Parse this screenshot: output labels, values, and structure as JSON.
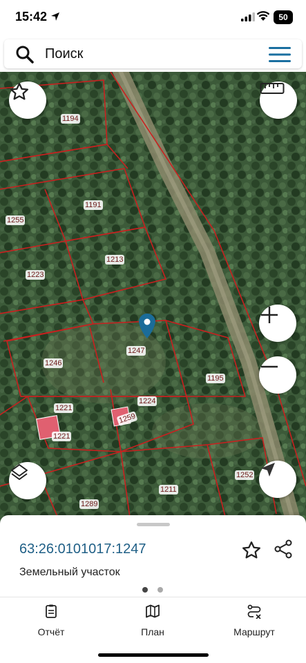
{
  "status_bar": {
    "time": "15:42",
    "battery": "50"
  },
  "search": {
    "placeholder": "Поиск"
  },
  "map": {
    "plot_labels": [
      "1194",
      "1191",
      "1255",
      "1213",
      "1223",
      "1247",
      "1246",
      "1195",
      "1221",
      "1224",
      "1259",
      "1221",
      "1252",
      "1211",
      "1289"
    ],
    "boundary_color": "#c9201f",
    "selected_fill": "#e06070"
  },
  "place": {
    "cadastral_number": "63:26:0101017:1247",
    "type": "Земельный участок"
  },
  "tabs": [
    {
      "label": "Отчёт",
      "icon": "report-icon"
    },
    {
      "label": "План",
      "icon": "map-plan-icon"
    },
    {
      "label": "Маршрут",
      "icon": "route-icon"
    }
  ]
}
